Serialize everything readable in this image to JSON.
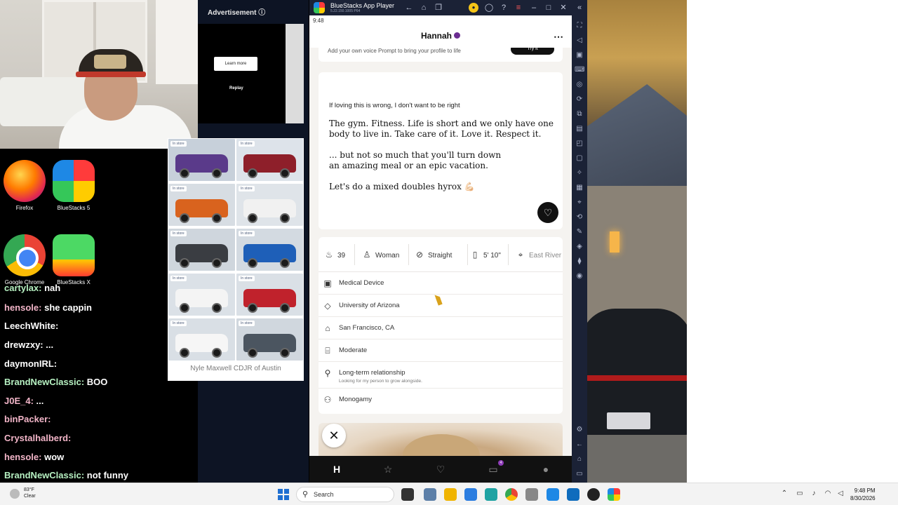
{
  "ad": {
    "label": "Advertisement",
    "learn_more": "Learn more",
    "replay": "Replay",
    "in_store": "In store",
    "dealer": "Nyle Maxwell CDJR of Austin"
  },
  "desktop": {
    "icons": [
      {
        "label": "Firefox"
      },
      {
        "label": "BlueStacks 5"
      },
      {
        "label": "Google Chrome"
      },
      {
        "label": "BlueStacks X"
      }
    ]
  },
  "chat": [
    {
      "user": "cartylax:",
      "msg": "nah"
    },
    {
      "user": "hensole:",
      "msg": "she cappin"
    },
    {
      "user": "LeechWhite:",
      "msg": ""
    },
    {
      "user": "drewzxy:",
      "msg": "..."
    },
    {
      "user": "daymonIRL:",
      "msg": ""
    },
    {
      "user": "BrandNewClassic:",
      "msg": "BOO"
    },
    {
      "user": "J0E_4:",
      "msg": "..."
    },
    {
      "user": "binPacker:",
      "msg": ""
    },
    {
      "user": "Crystalhalberd:",
      "msg": ""
    },
    {
      "user": "hensole:",
      "msg": "wow"
    },
    {
      "user": "BrandNewClassic:",
      "msg": "not funny"
    }
  ],
  "bluestacks": {
    "title": "BlueStacks App Player",
    "version": "5.22.150.1005 P64"
  },
  "phone": {
    "time": "9:48",
    "profile_name": "Hannah",
    "voice_prompt": "Add your own voice Prompt to bring your profile to life",
    "voice_button": "Try it",
    "prompt_question": "If loving this is wrong, I don't want to be right",
    "answer_1": "The gym. Fitness. Life is short and we only have one\nbody to live in. Take care of it. Love it. Respect it.",
    "answer_2": "... but not so much that you'll turn down\nan amazing meal or an epic vacation.",
    "answer_3": "Let's do a mixed doubles hyrox 💪🏻",
    "vitals": {
      "age": "39",
      "gender": "Woman",
      "orientation": "Straight",
      "height": "5' 10\"",
      "location": "East River"
    },
    "info": [
      {
        "icon": "briefcase-icon",
        "text": "Medical Device"
      },
      {
        "icon": "graduation-cap-icon",
        "text": "University of Arizona"
      },
      {
        "icon": "home-icon",
        "text": "San Francisco, CA"
      },
      {
        "icon": "religion-icon",
        "text": "Moderate"
      },
      {
        "icon": "search-icon",
        "text": "Long-term relationship",
        "sub": "Looking for my person to grow alongside."
      },
      {
        "icon": "relationship-icon",
        "text": "Monogamy"
      }
    ],
    "nav_badge": "4"
  },
  "taskbar": {
    "weather_temp": "83°F",
    "weather_desc": "Clear",
    "search": "Search",
    "time": "9:48 PM",
    "date": "8/30/2026"
  },
  "colors": {
    "bs_bg": "#1b2236",
    "hinge_purple": "#6b2c91",
    "win_blue": "#1f6fd1"
  }
}
